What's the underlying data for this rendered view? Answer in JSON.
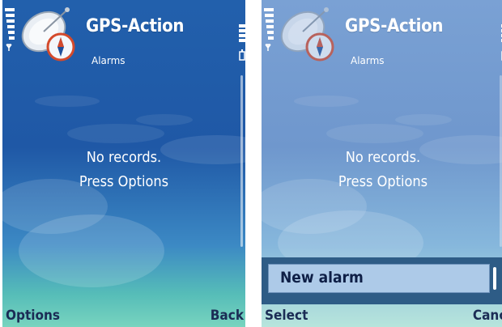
{
  "app_title": "GPS-Action",
  "view_title": "Alarms",
  "empty_message_line1": "No records.",
  "empty_message_line2": "Press Options",
  "left_screen": {
    "softkey_left": "Options",
    "softkey_right": "Back"
  },
  "right_screen": {
    "softkey_left": "Select",
    "softkey_right": "Cancel",
    "popup_item": "New alarm"
  },
  "colors": {
    "bg_top": "#1f58a6",
    "bg_bottom": "#6fd0c0",
    "dimmed_top": "#6f97cd",
    "dimmed_bottom": "#b7e5dc",
    "popup": "#2e5c86",
    "popup_highlight": "#adcae8",
    "softkey_text": "#1b2c55"
  },
  "icons": [
    "signal-strength-icon",
    "battery-icon",
    "satellite-dish-icon",
    "compass-icon",
    "scrollbar"
  ]
}
